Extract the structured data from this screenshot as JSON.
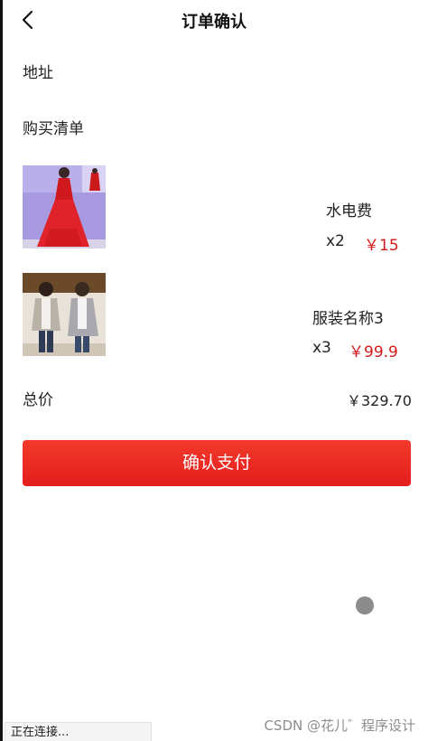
{
  "header": {
    "title": "订单确认"
  },
  "address": {
    "label": "地址"
  },
  "purchase_list": {
    "label": "购买清单",
    "items": [
      {
        "name": "水电费",
        "quantity": "x2",
        "price": "￥15",
        "image": "red-gown-photo"
      },
      {
        "name": "服装名称3",
        "quantity": "x3",
        "price": "￥99.9",
        "image": "grey-cardigan-photo"
      }
    ]
  },
  "total": {
    "label": "总价",
    "value": "￥329.70"
  },
  "pay_button": {
    "label": "确认支付"
  },
  "status": {
    "text": "正在连接..."
  },
  "watermark": {
    "text": "CSDN @花儿゛程序设计"
  },
  "colors": {
    "accent": "#e41d1d",
    "price": "#d31a1a"
  }
}
